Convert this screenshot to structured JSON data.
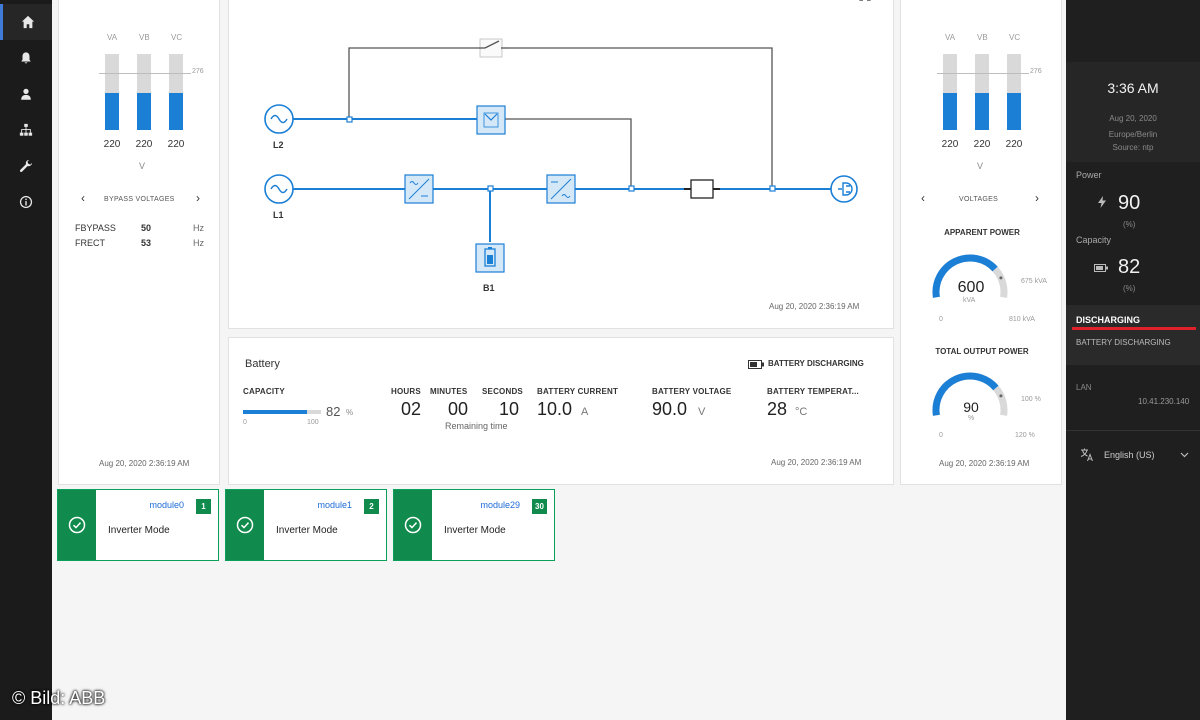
{
  "nav": {
    "items": [
      {
        "icon": "home-icon",
        "active": true
      },
      {
        "icon": "bell-icon"
      },
      {
        "icon": "user-icon"
      },
      {
        "icon": "hierarchy-icon"
      },
      {
        "icon": "wrench-icon"
      },
      {
        "icon": "info-icon"
      }
    ]
  },
  "bypass_card": {
    "phase_labels": [
      "VA",
      "VB",
      "VC"
    ],
    "limit": "276",
    "values": [
      "220",
      "220",
      "220"
    ],
    "levels": [
      220,
      220,
      220
    ],
    "unit": "V",
    "pager_label": "BYPASS VOLTAGES",
    "freq": [
      {
        "label": "FBYPASS",
        "value": "50",
        "unit": "Hz"
      },
      {
        "label": "FRECT",
        "value": "53",
        "unit": "Hz"
      }
    ],
    "timestamp": "Aug 20, 2020 2:36:19 AM"
  },
  "diagram": {
    "labels": {
      "l2": "L2",
      "l1": "L1",
      "b1": "B1"
    },
    "timestamp": "Aug 20, 2020 2:36:19 AM"
  },
  "battery": {
    "title": "Battery",
    "status": "BATTERY DISCHARGING",
    "capacity_label": "CAPACITY",
    "capacity_value": "82",
    "capacity_unit": "%",
    "capacity_fraction": 0.82,
    "capacity_min": "0",
    "capacity_max": "100",
    "hours_label": "HOURS",
    "minutes_label": "MINUTES",
    "seconds_label": "SECONDS",
    "hours": "02",
    "minutes": "00",
    "seconds": "10",
    "remaining": "Remaining time",
    "current_label": "BATTERY CURRENT",
    "current": "10.0",
    "current_unit": "A",
    "voltage_label": "BATTERY VOLTAGE",
    "voltage": "90.0",
    "voltage_unit": "V",
    "temp_label": "BATTERY TEMPERAT...",
    "temp": "28",
    "temp_unit": "°C",
    "timestamp": "Aug 20, 2020 2:36:19 AM"
  },
  "output_card": {
    "phase_labels": [
      "VA",
      "VB",
      "VC"
    ],
    "limit": "276",
    "values": [
      "220",
      "220",
      "220"
    ],
    "levels": [
      220,
      220,
      220
    ],
    "unit": "V",
    "pager_label": "VOLTAGES",
    "apparent": {
      "title": "APPARENT POWER",
      "value": "600",
      "unit": "kVA",
      "mark": "675 kVA",
      "min": "0",
      "max": "810 kVA",
      "fraction": 0.74
    },
    "total": {
      "title": "TOTAL OUTPUT POWER",
      "value": "90",
      "unit": "%",
      "mark": "100 %",
      "min": "0",
      "max": "120 %",
      "fraction": 0.75
    },
    "timestamp": "Aug 20, 2020 2:36:19 AM"
  },
  "modules": [
    {
      "name": "module0",
      "badge": "1",
      "mode": "Inverter Mode"
    },
    {
      "name": "module1",
      "badge": "2",
      "mode": "Inverter Mode"
    },
    {
      "name": "module29",
      "badge": "30",
      "mode": "Inverter Mode"
    }
  ],
  "side": {
    "time": "3:36 AM",
    "date": "Aug 20, 2020",
    "tz": "Europe/Berlin",
    "source": "Source: ntp",
    "power_label": "Power",
    "power_value": "90",
    "power_unit": "(%)",
    "capacity_label": "Capacity",
    "capacity_value": "82",
    "capacity_unit": "(%)",
    "alarm_title": "DISCHARGING",
    "alarm_text": "BATTERY DISCHARGING",
    "lan_label": "LAN",
    "lan_ip": "10.41.230.140",
    "language": "English (US)",
    "accent": "#e0202a"
  },
  "credit": "© Bild: ABB"
}
